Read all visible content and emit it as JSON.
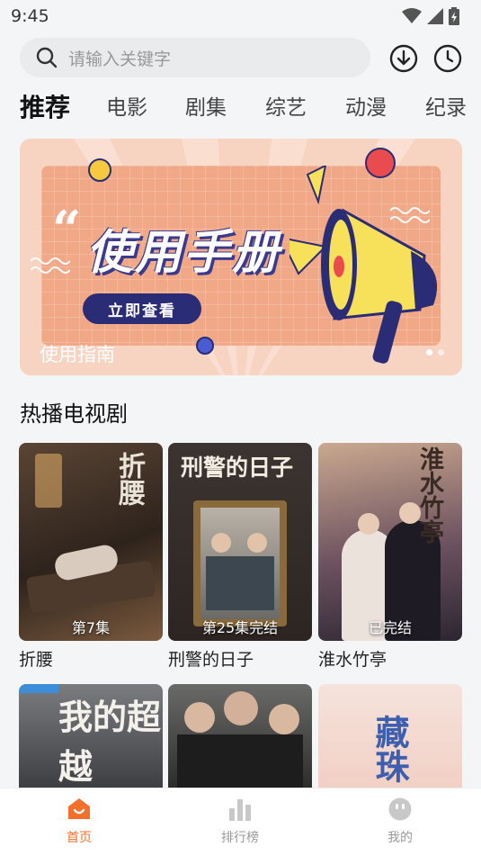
{
  "status": {
    "time": "9:45"
  },
  "search": {
    "placeholder": "请输入关键字"
  },
  "tabs": [
    {
      "label": "推荐"
    },
    {
      "label": "电影"
    },
    {
      "label": "剧集"
    },
    {
      "label": "综艺"
    },
    {
      "label": "动漫"
    },
    {
      "label": "纪录"
    }
  ],
  "banner": {
    "title": "使用手册",
    "button": "立即查看",
    "caption": "使用指南"
  },
  "section": {
    "title": "热播电视剧"
  },
  "dramas": [
    {
      "title": "折腰",
      "badge": "第7集",
      "poster_text": "折腰"
    },
    {
      "title": "刑警的日子",
      "badge": "第25集完结",
      "poster_text": "刑警的日子"
    },
    {
      "title": "淮水竹亭",
      "badge": "已完结",
      "poster_text": "淮水竹亭"
    }
  ],
  "dramas_row2": [
    {
      "poster_text": "我的超越"
    },
    {
      "poster_text": ""
    },
    {
      "poster_text": "藏珠"
    }
  ],
  "nav": [
    {
      "label": "首页"
    },
    {
      "label": "排行榜"
    },
    {
      "label": "我的"
    }
  ],
  "colors": {
    "accent": "#f3702c",
    "banner_navy": "#2b2c76"
  }
}
